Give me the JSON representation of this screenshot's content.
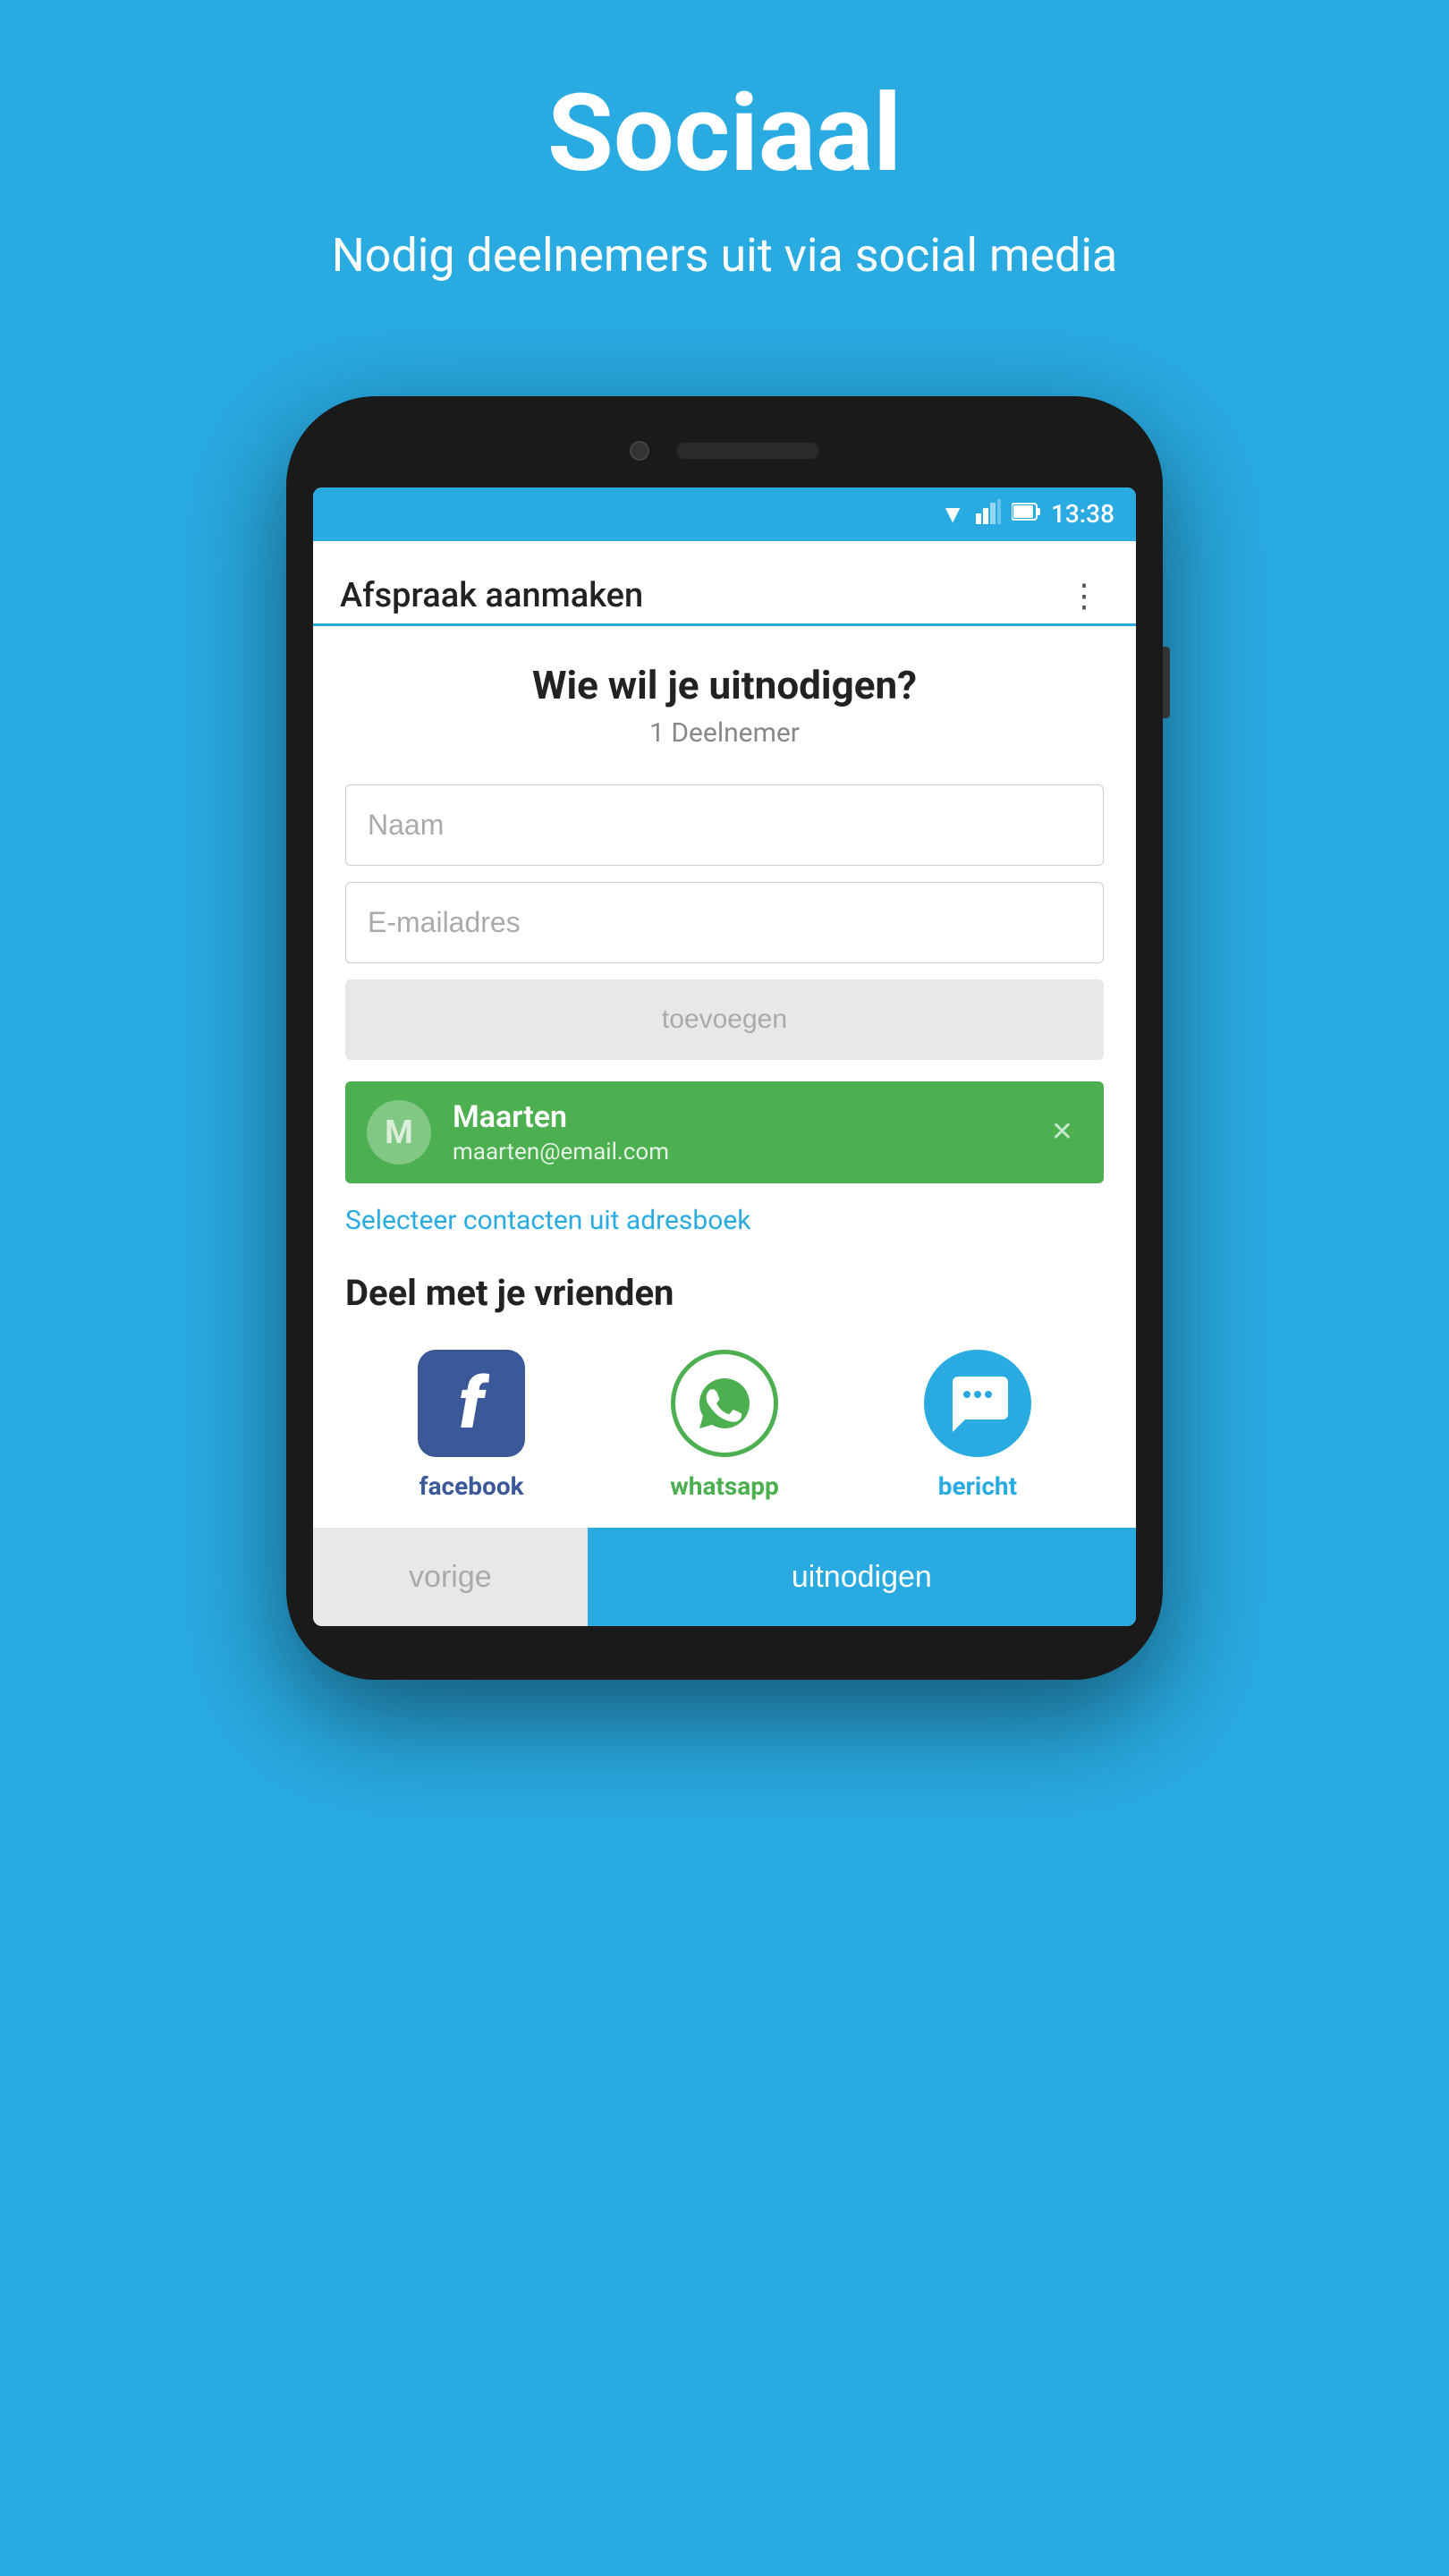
{
  "header": {
    "title": "Sociaal",
    "subtitle": "Nodig deelnemers uit via social media"
  },
  "statusBar": {
    "time": "13:38",
    "wifiIcon": "▼",
    "signalIcon": "▲",
    "batteryIcon": "▮"
  },
  "appBar": {
    "title": "Afspraak aanmaken",
    "menuIcon": "⋮"
  },
  "inviteSection": {
    "title": "Wie wil je uitnodigen?",
    "participantCount": "1 Deelnemer",
    "namePlaceholder": "Naam",
    "emailPlaceholder": "E-mailadres",
    "addButtonLabel": "toevoegen"
  },
  "participant": {
    "avatarLetter": "M",
    "name": "Maarten",
    "email": "maarten@email.com",
    "removeIcon": "✕"
  },
  "addressBookLink": "Selecteer contacten uit adresboek",
  "shareSection": {
    "title": "Deel met je vrienden",
    "buttons": [
      {
        "id": "facebook",
        "label": "facebook",
        "iconText": "f"
      },
      {
        "id": "whatsapp",
        "label": "whatsapp",
        "iconText": "💬"
      },
      {
        "id": "bericht",
        "label": "bericht",
        "iconText": "..."
      }
    ]
  },
  "bottomNav": {
    "backLabel": "vorige",
    "inviteLabel": "uitnodigen"
  }
}
